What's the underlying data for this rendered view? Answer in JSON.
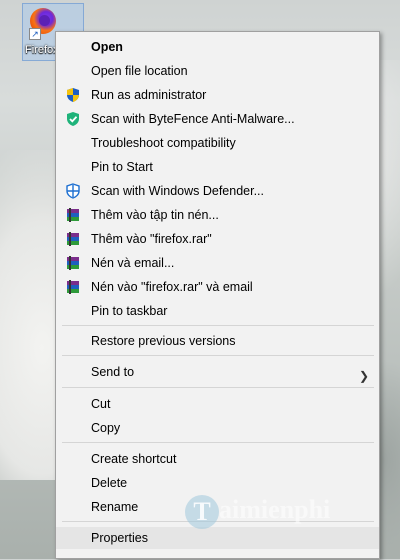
{
  "desktop_icon": {
    "label": "Firefox"
  },
  "menu": {
    "open": "Open",
    "open_file_location": "Open file location",
    "run_as_admin": "Run as administrator",
    "scan_bytefence": "Scan with ByteFence Anti-Malware...",
    "troubleshoot": "Troubleshoot compatibility",
    "pin_start": "Pin to Start",
    "scan_defender": "Scan with Windows Defender...",
    "rar_add_archive": "Thêm vào tập tin nén...",
    "rar_add_firefox": "Thêm vào \"firefox.rar\"",
    "rar_compress_email": "Nén và email...",
    "rar_compress_firefox_email": "Nén vào \"firefox.rar\" và email",
    "pin_taskbar": "Pin to taskbar",
    "restore_versions": "Restore previous versions",
    "send_to": "Send to",
    "cut": "Cut",
    "copy": "Copy",
    "create_shortcut": "Create shortcut",
    "delete": "Delete",
    "rename": "Rename",
    "properties": "Properties"
  },
  "watermark": {
    "text": "aimienphi",
    "initial": "T"
  },
  "icons": {
    "shield": "uac-shield-icon",
    "bytefence": "bytefence-shield-icon",
    "defender": "windows-defender-icon",
    "winrar": "winrar-books-icon",
    "submenu": "chevron-right-icon"
  }
}
